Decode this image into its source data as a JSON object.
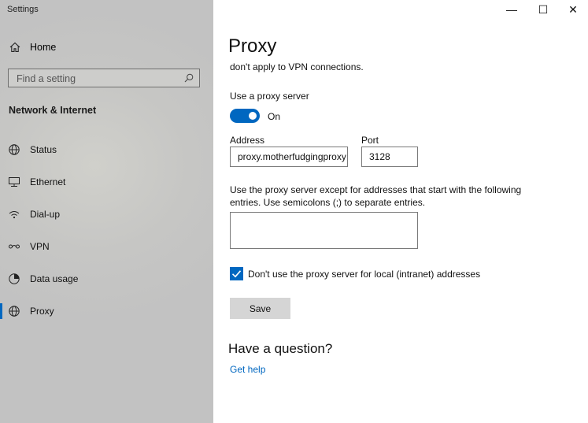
{
  "app": {
    "title": "Settings"
  },
  "sidebar": {
    "home_label": "Home",
    "search_placeholder": "Find a setting",
    "section_title": "Network & Internet",
    "items": [
      {
        "label": "Status",
        "icon": "globe-icon"
      },
      {
        "label": "Ethernet",
        "icon": "ethernet-icon"
      },
      {
        "label": "Dial-up",
        "icon": "dialup-icon"
      },
      {
        "label": "VPN",
        "icon": "vpn-icon"
      },
      {
        "label": "Data usage",
        "icon": "data-usage-icon"
      },
      {
        "label": "Proxy",
        "icon": "globe-icon",
        "active": true
      }
    ]
  },
  "window_controls": {
    "minimize": "—",
    "maximize": "☐",
    "close": "✕"
  },
  "main": {
    "title": "Proxy",
    "cut_text": "don't apply to VPN connections.",
    "proxy_toggle_label": "Use a proxy server",
    "proxy_toggle_state": "On",
    "address_label": "Address",
    "address_value": "proxy.motherfudgingproxy",
    "port_label": "Port",
    "port_value": "3128",
    "exceptions_text": "Use the proxy server except for addresses that start with the following entries. Use semicolons (;) to separate entries.",
    "exceptions_value": "",
    "local_checkbox_label": "Don't use the proxy server for local (intranet) addresses",
    "local_checkbox_checked": true,
    "save_label": "Save",
    "question_title": "Have a question?",
    "help_link": "Get help"
  },
  "colors": {
    "accent": "#0067c0",
    "sidebar_bg": "#c4c4c4",
    "button_bg": "#d5d5d5"
  }
}
